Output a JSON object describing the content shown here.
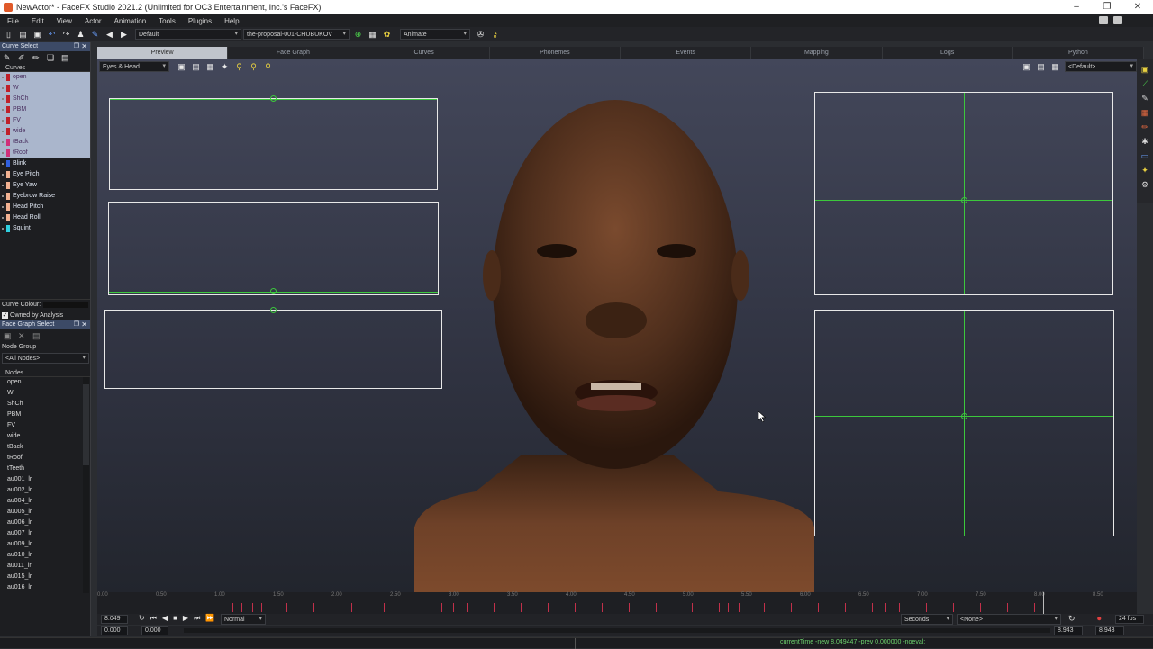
{
  "window": {
    "title": "NewActor* - FaceFX Studio 2021.2 (Unlimited for OC3 Entertainment, Inc.'s FaceFX)",
    "controls": [
      "–",
      "❐",
      "✕"
    ]
  },
  "menu": [
    "File",
    "Edit",
    "View",
    "Actor",
    "Animation",
    "Tools",
    "Plugins",
    "Help"
  ],
  "toolbar": {
    "profile": "Default",
    "animation_group": "the-proposal-001-CHUBUKOV",
    "mode": "Animate"
  },
  "curve_select": {
    "title": "Curve Select",
    "section": "Curves",
    "curves": [
      {
        "name": "open",
        "color": "#c0202a",
        "selected": true
      },
      {
        "name": "W",
        "color": "#c0202a",
        "selected": true
      },
      {
        "name": "ShCh",
        "color": "#c0202a",
        "selected": true
      },
      {
        "name": "PBM",
        "color": "#c0202a",
        "selected": true
      },
      {
        "name": "FV",
        "color": "#c0202a",
        "selected": true
      },
      {
        "name": "wide",
        "color": "#c0202a",
        "selected": true
      },
      {
        "name": "tBack",
        "color": "#d0307a",
        "selected": true
      },
      {
        "name": "tRoof",
        "color": "#d0307a",
        "selected": true
      },
      {
        "name": "Blink",
        "color": "#3060e0",
        "selected": false
      },
      {
        "name": "Eye Pitch",
        "color": "#f0b090",
        "selected": false
      },
      {
        "name": "Eye Yaw",
        "color": "#f0b090",
        "selected": false
      },
      {
        "name": "Eyebrow Raise",
        "color": "#f0b090",
        "selected": false
      },
      {
        "name": "Head Pitch",
        "color": "#f0b090",
        "selected": false
      },
      {
        "name": "Head Roll",
        "color": "#f0b090",
        "selected": false
      },
      {
        "name": "Squint",
        "color": "#30d0e0",
        "selected": false
      }
    ],
    "curve_colour_label": "Curve Colour:",
    "owned_by_analysis": "Owned by Analysis"
  },
  "face_graph_select": {
    "title": "Face Graph Select",
    "node_group_label": "Node Group",
    "node_group_value": "<All Nodes>",
    "nodes_label": "Nodes",
    "nodes": [
      "open",
      "W",
      "ShCh",
      "PBM",
      "FV",
      "wide",
      "tBack",
      "tRoof",
      "tTeeth",
      "au001_lr",
      "au002_lr",
      "au004_lr",
      "au005_lr",
      "au006_lr",
      "au007_lr",
      "au009_lr",
      "au010_lr",
      "au011_lr",
      "au015_lr",
      "au016_lr"
    ]
  },
  "tabs": [
    {
      "label": "Preview",
      "active": true
    },
    {
      "label": "Face Graph",
      "active": false
    },
    {
      "label": "Curves",
      "active": false
    },
    {
      "label": "Phonemes",
      "active": false
    },
    {
      "label": "Events",
      "active": false
    },
    {
      "label": "Mapping",
      "active": false
    },
    {
      "label": "Logs",
      "active": false
    },
    {
      "label": "Python",
      "active": false
    }
  ],
  "preview": {
    "camera": "Eyes & Head",
    "view_preset": "<Default>"
  },
  "timeline": {
    "ticks": [
      "0.00",
      "0.50",
      "1.00",
      "1.50",
      "2.00",
      "2.50",
      "3.00",
      "3.50",
      "4.00",
      "4.50",
      "5.00",
      "5.50",
      "6.00",
      "6.50",
      "7.00",
      "7.50",
      "8.00",
      "8.50"
    ],
    "current_time": "8.049",
    "start": "0.000",
    "start2": "0.000",
    "playback_mode": "Normal",
    "time_units": "Seconds",
    "overlay": "<None>",
    "end": "8.943",
    "end2": "8.943",
    "fps": "24 fps"
  },
  "status": {
    "message": "currentTime -new 8.049447 -prev 0.000000 -noeval;"
  }
}
